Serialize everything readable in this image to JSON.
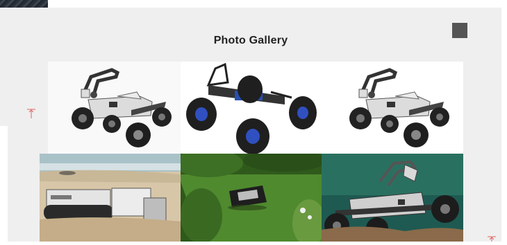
{
  "gallery": {
    "title": "Photo Gallery",
    "photos": [
      {
        "subject": "rover-with-robot-arm"
      },
      {
        "subject": "rc-monster-truck"
      },
      {
        "subject": "rover-with-robot-arm"
      },
      {
        "subject": "tracked-robot-on-beach"
      },
      {
        "subject": "robotic-lawn-mower"
      },
      {
        "subject": "rover-on-rocks"
      }
    ]
  },
  "icons": {
    "stop": "stop-square-icon",
    "arrow_marker": "up-arrow-marker-icon"
  },
  "colors": {
    "panel": "#efefef",
    "marker": "#e06060",
    "button": "#555555",
    "title": "#222222"
  }
}
